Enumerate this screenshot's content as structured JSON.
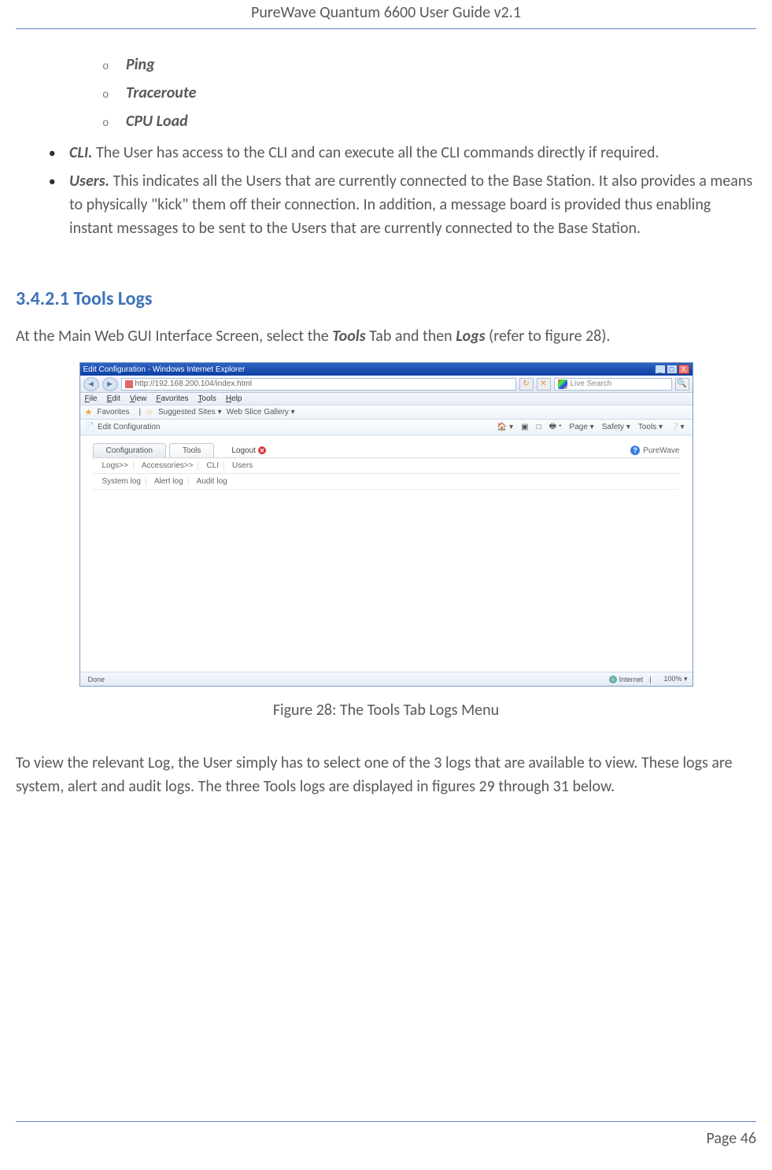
{
  "header": {
    "title": "PureWave Quantum 6600 User Guide v2.1"
  },
  "sublist": {
    "marker": "o",
    "items": [
      "Ping",
      "Traceroute",
      "CPU Load"
    ]
  },
  "bullets": {
    "cli": {
      "lead": "CLI.",
      "text": " The User has access to the CLI and can execute all the CLI commands directly if required."
    },
    "users": {
      "lead": "Users.",
      "text": " This indicates all the Users that are currently connected to the Base Station. It also provides a means to physically \"kick\" them off their connection. In addition, a message board is provided thus enabling instant messages to be sent to the Users that are currently connected to the Base Station."
    }
  },
  "section": {
    "heading": "3.4.2.1 Tools Logs"
  },
  "para1": {
    "pre": "At the Main Web GUI Interface Screen, select the ",
    "b1": "Tools",
    "mid": " Tab and then ",
    "b2": "Logs",
    "post": " (refer to figure 28)."
  },
  "figure": {
    "caption": "Figure 28: The Tools Tab Logs Menu"
  },
  "para2": "To view the relevant Log, the User simply has to select one of the 3 logs that are available to view. These logs are system, alert and audit logs. The three Tools logs are displayed in figures 29 through 31 below.",
  "footer": {
    "page": "Page 46"
  },
  "ie": {
    "title": "Edit Configuration - Windows Internet Explorer",
    "winbtns": {
      "min": "_",
      "max": "□",
      "close": "X"
    },
    "nav": {
      "back": "◄",
      "fwd": "►"
    },
    "addr": "http://192.168.200.104/index.html",
    "addr_refresh": "↻",
    "addr_stop": "✕",
    "search_placeholder": "Live Search",
    "menu": [
      "File",
      "Edit",
      "View",
      "Favorites",
      "Tools",
      "Help"
    ],
    "fav": {
      "label": "Favorites",
      "suggested": "Suggested Sites ▾",
      "slice": "Web Slice Gallery ▾"
    },
    "cmd": {
      "tab": "Edit Configuration",
      "right": [
        "🏠 ▾",
        "▣",
        "□",
        "🖶 ▾",
        "Page ▾",
        "Safety ▾",
        "Tools ▾",
        "❔▾"
      ]
    },
    "app": {
      "tabs": {
        "config": "Configuration",
        "tools": "Tools"
      },
      "logout": "Logout",
      "brand": "PureWave",
      "sub1": [
        "Logs>>",
        "Accessories>>",
        "CLI",
        "Users"
      ],
      "sub2": [
        "System log",
        "Alert log",
        "Audit log"
      ]
    },
    "status": {
      "done": "Done",
      "zone": "Internet",
      "protected": "",
      "zoom": "100%  ▾"
    }
  }
}
